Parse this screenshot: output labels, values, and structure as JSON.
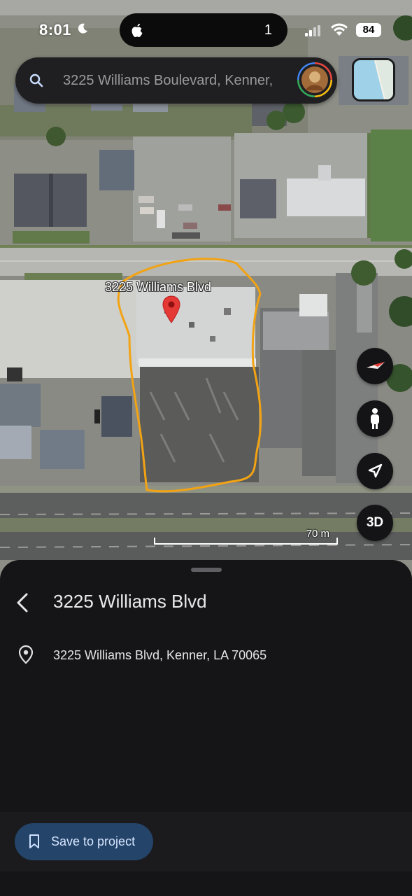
{
  "status_bar": {
    "time": "8:01",
    "island_count": "1",
    "battery": "84"
  },
  "search": {
    "placeholder": "3225 Williams Boulevard, Kenner,"
  },
  "map": {
    "place_label": "3225 Williams Blvd",
    "scale_label": "70 m",
    "buttons": {
      "three_d": "3D"
    },
    "icons": [
      "compass-icon",
      "pegman-icon",
      "my-location-icon",
      "layers-icon",
      "search-icon",
      "map-pin-icon"
    ],
    "colors": {
      "outline": "#f2a313",
      "pin": "#e53935"
    }
  },
  "sheet": {
    "title": "3225 Williams Blvd",
    "address": "3225 Williams Blvd, Kenner, LA 70065",
    "save_label": "Save to project"
  }
}
